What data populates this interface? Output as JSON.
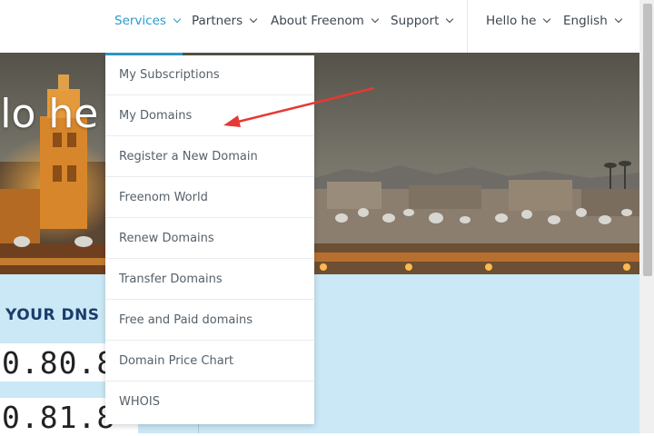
{
  "nav": {
    "items": [
      {
        "label": "Services",
        "active": true
      },
      {
        "label": "Partners"
      },
      {
        "label": "About Freenom"
      },
      {
        "label": "Support"
      }
    ],
    "user_label": "Hello he",
    "language_label": "English"
  },
  "hero": {
    "title": "llo he"
  },
  "dropdown": {
    "items": [
      "My Subscriptions",
      "My Domains",
      "Register a New Domain",
      "Freenom World",
      "Renew Domains",
      "Transfer Domains",
      "Free and Paid domains",
      "Domain Price Chart",
      "WHOIS"
    ]
  },
  "dns": {
    "heading": "YOUR DNS T",
    "ips": [
      "0.80.8",
      "0.81.8"
    ]
  },
  "colors": {
    "accent": "#2a9bcd",
    "lower_bg": "#cbe8f6",
    "heading": "#1b3c6b",
    "arrow": "#e53935"
  }
}
